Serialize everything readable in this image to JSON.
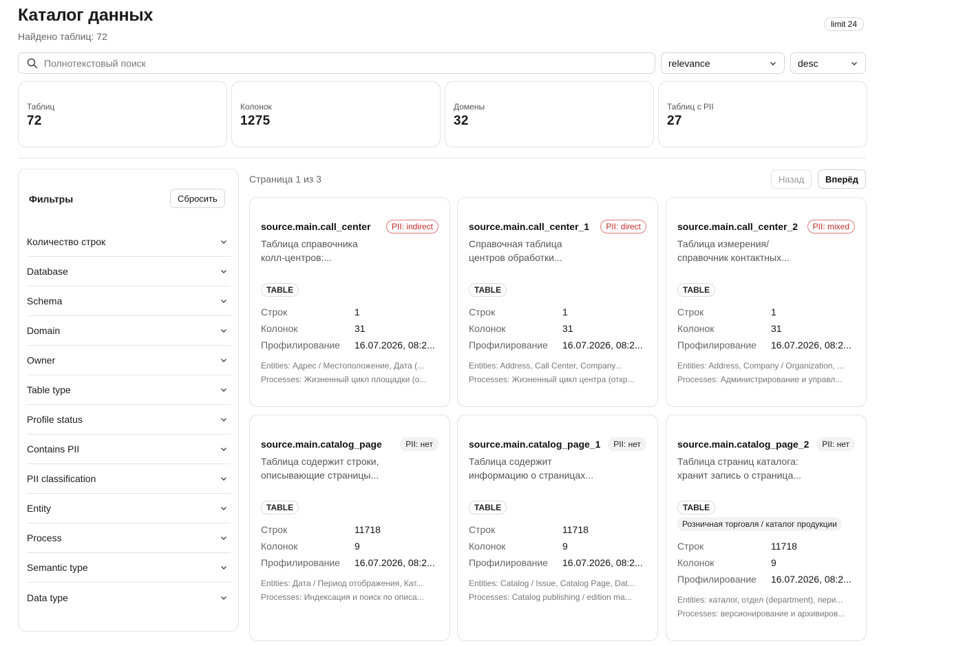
{
  "header": {
    "title": "Каталог данных",
    "found": "Найдено таблиц: 72",
    "limit_badge": "limit 24"
  },
  "search": {
    "placeholder": "Полнотекстовый поиск",
    "value": ""
  },
  "sort": {
    "field": "relevance",
    "order": "desc"
  },
  "stats": [
    {
      "label": "Таблиц",
      "value": "72"
    },
    {
      "label": "Колонок",
      "value": "1275"
    },
    {
      "label": "Домены",
      "value": "32"
    },
    {
      "label": "Таблиц с PII",
      "value": "27"
    }
  ],
  "filters": {
    "title": "Фильтры",
    "reset_label": "Сбросить",
    "items": [
      "Количество строк",
      "Database",
      "Schema",
      "Domain",
      "Owner",
      "Table type",
      "Profile status",
      "Contains PII",
      "PII classification",
      "Entity",
      "Process",
      "Semantic type",
      "Data type"
    ]
  },
  "pager": {
    "info": "Страница 1 из 3",
    "prev_label": "Назад",
    "next_label": "Вперёд"
  },
  "labels": {
    "rows": "Строк",
    "columns": "Колонок",
    "profiling": "Профилирование"
  },
  "cards": [
    {
      "name": "source.main.call_center",
      "pii": "PII: indirect",
      "desc_line1": "Таблица справочника",
      "desc_line2": "колл-центров:...",
      "type": "TABLE",
      "domain": "",
      "rows": "1",
      "columns": "31",
      "profiling": "16.07.2026, 08:2...",
      "entities": "Entities: Адрес / Местоположение, Дата (...",
      "processes": "Processes: Жизненный цикл площадки (о..."
    },
    {
      "name": "source.main.call_center_1",
      "pii": "PII: direct",
      "desc_line1": "Справочная таблица",
      "desc_line2": "центров обработки...",
      "type": "TABLE",
      "domain": "",
      "rows": "1",
      "columns": "31",
      "profiling": "16.07.2026, 08:2...",
      "entities": "Entities: Address, Call Center, Company...",
      "processes": "Processes: Жизненный цикл центра (откр..."
    },
    {
      "name": "source.main.call_center_2",
      "pii": "PII: mixed",
      "desc_line1": "Таблица измерения/",
      "desc_line2": "справочник контактных...",
      "type": "TABLE",
      "domain": "",
      "rows": "1",
      "columns": "31",
      "profiling": "16.07.2026, 08:2...",
      "entities": "Entities: Address, Company / Organization, ...",
      "processes": "Processes: Администрирование и управл..."
    },
    {
      "name": "source.main.catalog_page",
      "pii": "PII: нет",
      "desc_line1": "Таблица содержит строки,",
      "desc_line2": "описывающие страницы...",
      "type": "TABLE",
      "domain": "",
      "rows": "11718",
      "columns": "9",
      "profiling": "16.07.2026, 08:2...",
      "entities": "Entities: Дата / Период отображения, Кат...",
      "processes": "Processes: Индексация и поиск по описа..."
    },
    {
      "name": "source.main.catalog_page_1",
      "pii": "PII: нет",
      "desc_line1": "Таблица содержит",
      "desc_line2": "информацию о страницах...",
      "type": "TABLE",
      "domain": "",
      "rows": "11718",
      "columns": "9",
      "profiling": "16.07.2026, 08:2...",
      "entities": "Entities: Catalog / Issue, Catalog Page, Dat...",
      "processes": "Processes: Catalog publishing / edition ma..."
    },
    {
      "name": "source.main.catalog_page_2",
      "pii": "PII: нет",
      "desc_line1": "Таблица страниц каталога:",
      "desc_line2": "хранит запись о страница...",
      "type": "TABLE",
      "domain": "Розничная торговля / каталог продукции",
      "rows": "11718",
      "columns": "9",
      "profiling": "16.07.2026, 08:2...",
      "entities": "Entities: каталог, отдел (department), пери...",
      "processes": "Processes: версионирование и архивиров..."
    }
  ]
}
